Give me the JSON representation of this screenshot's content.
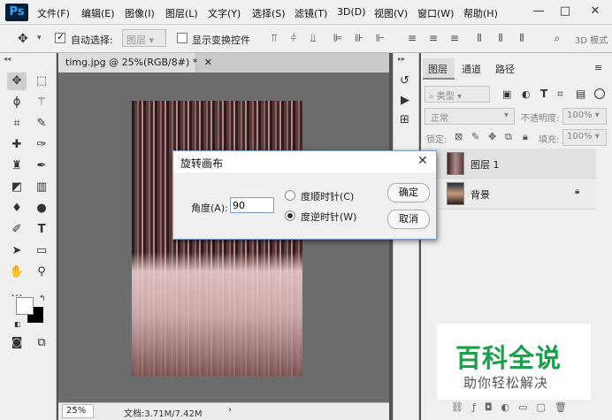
{
  "app": {
    "logo": "Ps"
  },
  "menu": [
    "文件(F)",
    "编辑(E)",
    "图像(I)",
    "图层(L)",
    "文字(Y)",
    "选择(S)",
    "滤镜(T)",
    "3D(D)",
    "视图(V)",
    "窗口(W)",
    "帮助(H)"
  ],
  "window_controls": {
    "minimize": "—",
    "maximize": "□",
    "close": "✕"
  },
  "options": {
    "auto_select_label": "自动选择:",
    "auto_select_value": "图层",
    "transform_controls_label": "显示变换控件",
    "mode_3d": "3D 模式"
  },
  "document": {
    "tab_title": "timg.jpg @ 25%(RGB/8#) *",
    "zoom": "25%",
    "doc_info": "文档:3.71M/7.42M"
  },
  "panel": {
    "tabs": [
      "图层",
      "通道",
      "路径"
    ],
    "filter_type": "类型",
    "blend_mode": "正常",
    "opacity_label": "不透明度:",
    "opacity_value": "100%",
    "lock_label": "锁定:",
    "fill_label": "填充:",
    "fill_value": "100%",
    "layers": [
      {
        "name": "图层 1",
        "locked": false
      },
      {
        "name": "背景",
        "locked": true
      }
    ]
  },
  "dialog": {
    "title": "旋转画布",
    "angle_label": "角度(A):",
    "angle_value": "90",
    "cw_label": "度顺时针(C)",
    "ccw_label": "度逆时针(W)",
    "selected": "ccw",
    "ok_label": "确定",
    "cancel_label": "取消"
  },
  "watermark": {
    "title": "百科全说",
    "subtitle": "助你轻松解决",
    "title_color": "#1aa04a"
  }
}
